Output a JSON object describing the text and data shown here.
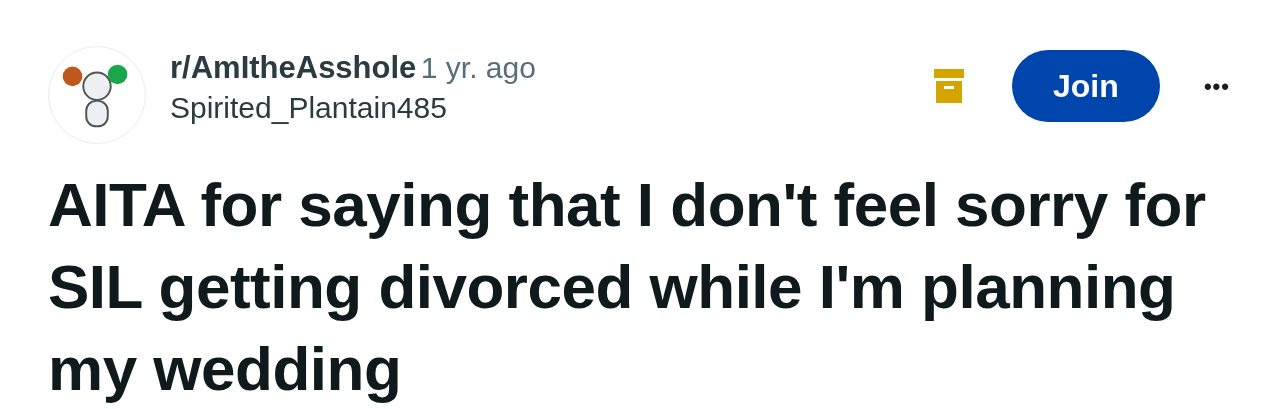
{
  "post": {
    "subreddit": "r/AmItheAsshole",
    "time": "1 yr. ago",
    "author": "Spirited_Plantain485",
    "join_button": "Join",
    "more_button": "•••",
    "title": "AITA for saying that I don't feel sorry for SIL getting divorced while I'm planning my wedding"
  }
}
